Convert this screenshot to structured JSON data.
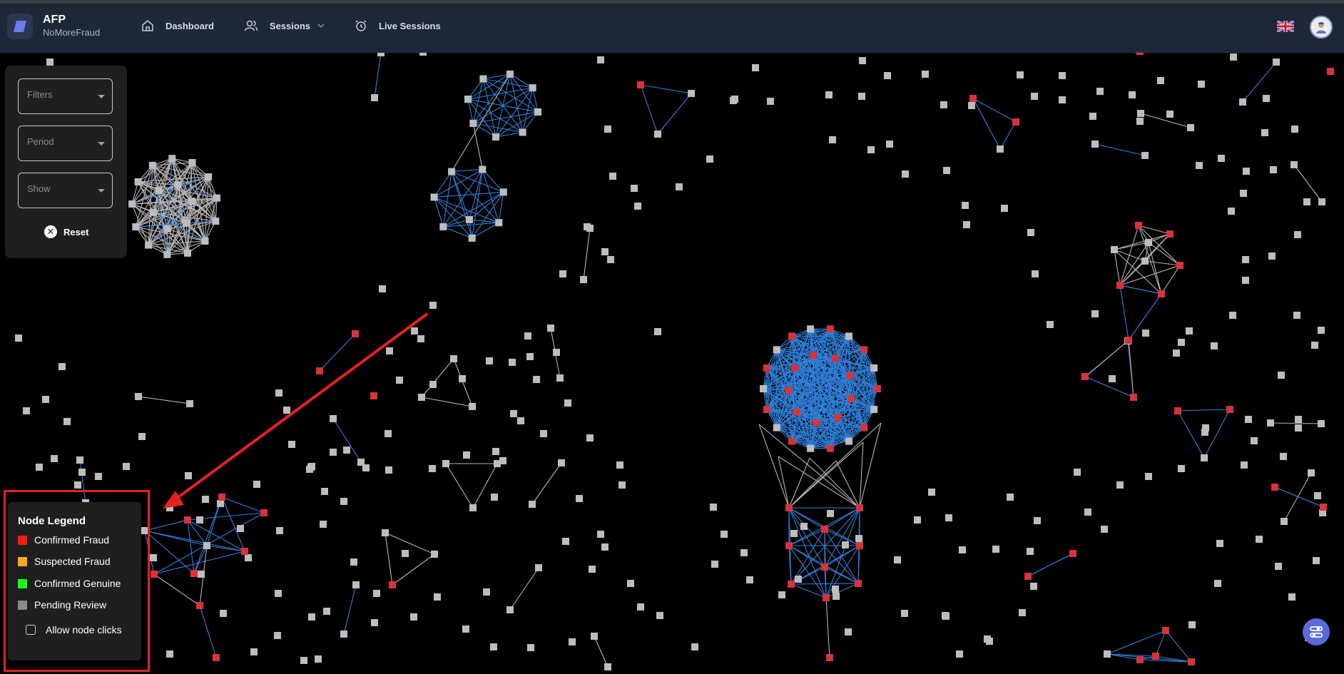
{
  "brand": {
    "name": "AFP",
    "subtitle": "NoMoreFraud"
  },
  "nav": {
    "dashboard": "Dashboard",
    "sessions": "Sessions",
    "live_sessions": "Live Sessions"
  },
  "filters": {
    "filters_placeholder": "Filters",
    "period_placeholder": "Period",
    "show_placeholder": "Show",
    "reset_label": "Reset"
  },
  "legend": {
    "title": "Node Legend",
    "items": [
      {
        "label": "Confirmed Fraud",
        "color": "#ff1a1a"
      },
      {
        "label": "Suspected Fraud",
        "color": "#ffa81a"
      },
      {
        "label": "Confirmed Genuine",
        "color": "#1aff1a"
      },
      {
        "label": "Pending Review",
        "color": "#8a8a8a"
      }
    ],
    "allow_clicks_label": "Allow node clicks"
  },
  "colors": {
    "fraud_node": "#d9323a",
    "pending_node": "#bdbdbd",
    "edge_blue": "#2f7fd8",
    "edge_gray": "#b5b5b5",
    "annotation_red": "#e42222",
    "navbar_bg": "#1d2736"
  },
  "icons": {
    "dashboard": "home-icon",
    "sessions": "users-icon",
    "live_sessions": "live-clock-icon",
    "language": "uk-flag-icon",
    "reset": "close-circle-icon",
    "fab": "settings-sliders-icon"
  }
}
